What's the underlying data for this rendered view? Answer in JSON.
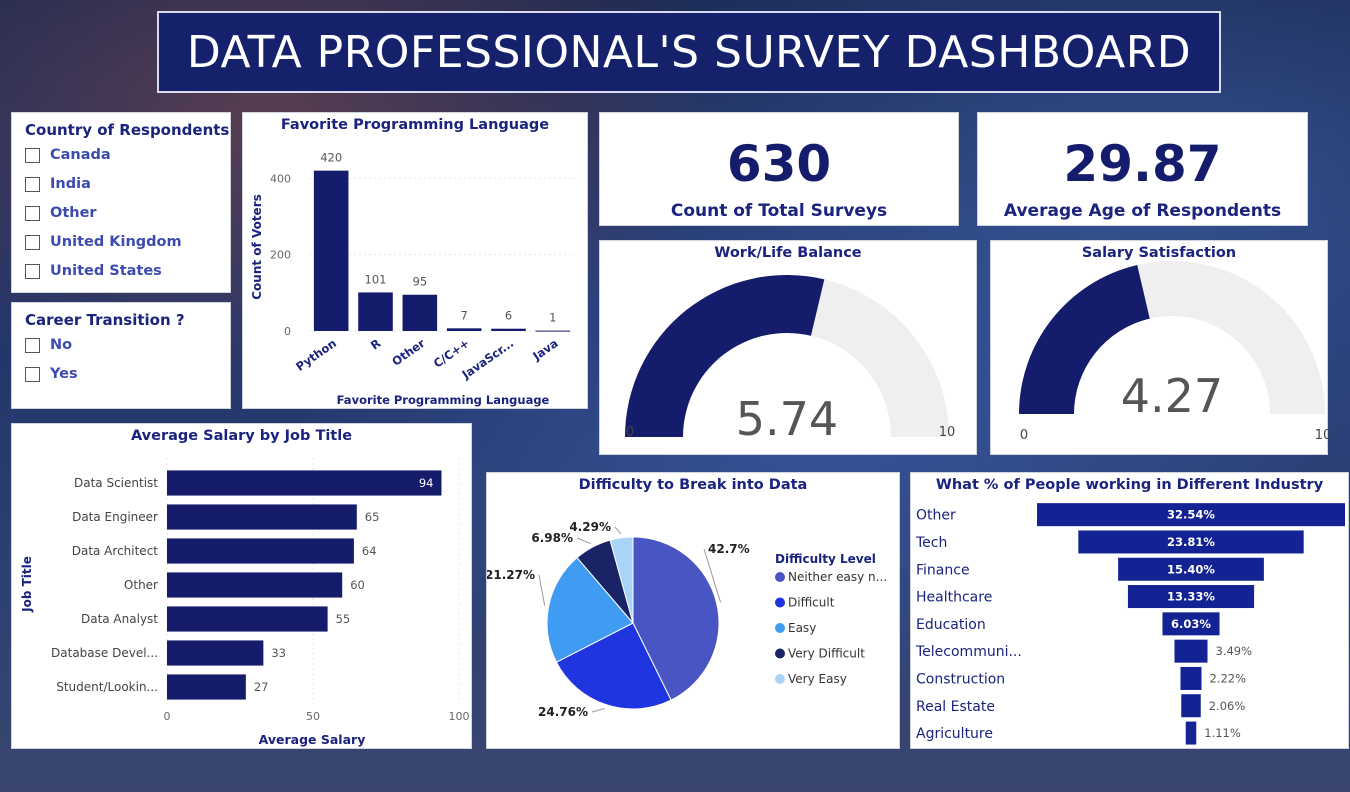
{
  "header": {
    "title": "DATA PROFESSIONAL'S SURVEY DASHBOARD"
  },
  "colors": {
    "navy": "#141c6b",
    "banner": "#15226b",
    "gauge_track": "#efefef"
  },
  "country_slicer": {
    "title": "Country of Respondents",
    "items": [
      "Canada",
      "India",
      "Other",
      "United Kingdom",
      "United States"
    ]
  },
  "career_slicer": {
    "title": "Career Transition ?",
    "items": [
      "No",
      "Yes"
    ]
  },
  "kpis": {
    "surveys": {
      "value": "630",
      "label": "Count of Total Surveys"
    },
    "age": {
      "value": "29.87",
      "label": "Average Age of Respondents"
    }
  },
  "gauges": [
    {
      "title": "Work/Life Balance",
      "value": 5.74,
      "value_label": "5.74",
      "min_label": "0",
      "max_label": "10",
      "max": 10
    },
    {
      "title": "Salary Satisfaction",
      "value": 4.27,
      "value_label": "4.27",
      "min_label": "0",
      "max_label": "10",
      "max": 10
    }
  ],
  "chart_data": [
    {
      "id": "language",
      "type": "bar",
      "title": "Favorite Programming Language",
      "xlabel": "Favorite Programming Language",
      "ylabel": "Count of Voters",
      "categories": [
        "Python",
        "R",
        "Other",
        "C/C++",
        "JavaScr...",
        "Java"
      ],
      "values": [
        420,
        101,
        95,
        7,
        6,
        1
      ],
      "yticks": [
        0,
        200,
        400
      ],
      "ylim": [
        0,
        440
      ]
    },
    {
      "id": "salary",
      "type": "bar",
      "orientation": "horizontal",
      "title": "Average Salary by Job Title",
      "xlabel": "Average Salary",
      "ylabel": "Job Title",
      "categories": [
        "Data Scientist",
        "Data Engineer",
        "Data Architect",
        "Other",
        "Data Analyst",
        "Database Devel...",
        "Student/Lookin..."
      ],
      "values": [
        94,
        65,
        64,
        60,
        55,
        33,
        27
      ],
      "xticks": [
        0,
        50,
        100
      ],
      "xlim": [
        0,
        100
      ]
    },
    {
      "id": "difficulty",
      "type": "pie",
      "title": "Difficulty to Break into Data",
      "legend_title": "Difficulty Level",
      "legend_placement": "right",
      "slices": [
        {
          "name": "Neither easy n...",
          "value": 42.7,
          "label": "42.7%",
          "color": "#4a55c4"
        },
        {
          "name": "Difficult",
          "value": 24.76,
          "label": "24.76%",
          "color": "#1f35e0"
        },
        {
          "name": "Easy",
          "value": 21.27,
          "label": "21.27%",
          "color": "#3f9cf2"
        },
        {
          "name": "Very Difficult",
          "value": 6.98,
          "label": "6.98%",
          "color": "#1a2366"
        },
        {
          "name": "Very Easy",
          "value": 4.29,
          "label": "4.29%",
          "color": "#a8d4f7"
        }
      ]
    },
    {
      "id": "industry",
      "type": "bar",
      "subtype": "funnel",
      "title": "What % of People working in Different Industry",
      "categories": [
        "Other",
        "Tech",
        "Finance",
        "Healthcare",
        "Education",
        "Telecommuni...",
        "Construction",
        "Real Estate",
        "Agriculture"
      ],
      "values": [
        32.54,
        23.81,
        15.4,
        13.33,
        6.03,
        3.49,
        2.22,
        2.06,
        1.11
      ],
      "labels": [
        "32.54%",
        "23.81%",
        "15.40%",
        "13.33%",
        "6.03%",
        "3.49%",
        "2.22%",
        "2.06%",
        "1.11%"
      ]
    }
  ]
}
